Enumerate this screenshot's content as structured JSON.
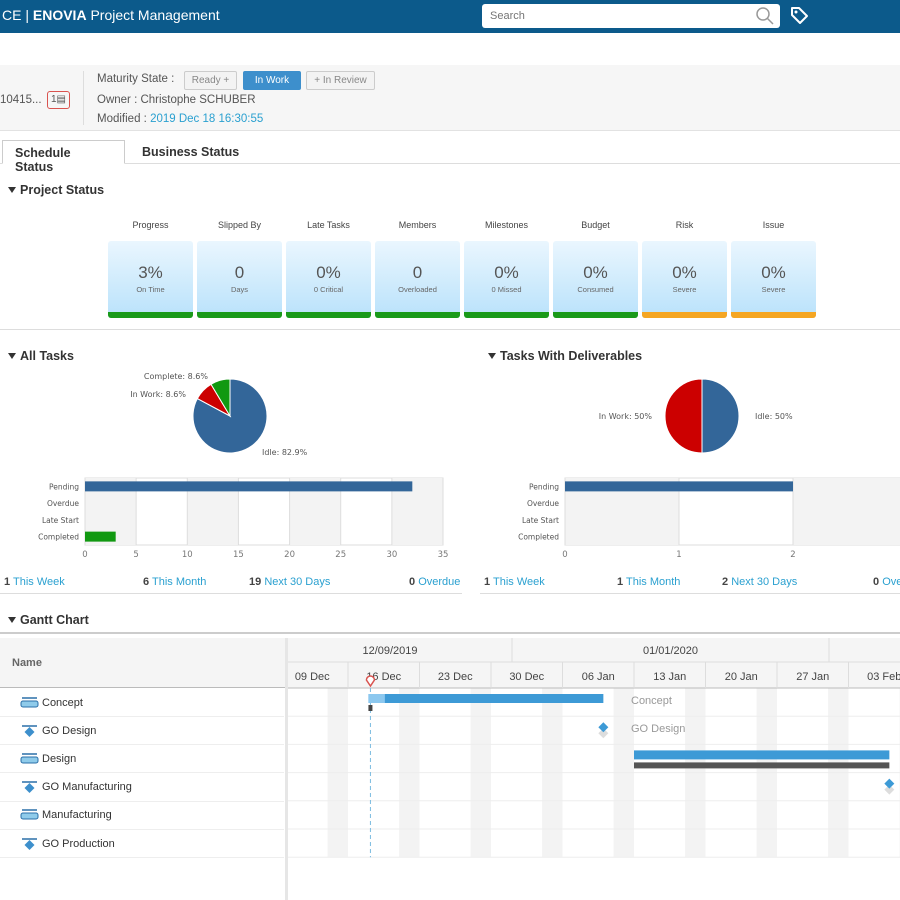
{
  "app": {
    "title_prefix": "CE | ",
    "brand": "ENOVIA",
    "title": " Project Management",
    "search_placeholder": "Search",
    "icons": [
      "search-icon",
      "tag-icon"
    ]
  },
  "object": {
    "id": "10415...",
    "badge": "1",
    "maturity_label": "Maturity State :",
    "states": [
      "Ready",
      "In Work",
      "In Review"
    ],
    "active_state": "In Work",
    "owner": "Owner : Christophe SCHUBER",
    "modified_label": "Modified :",
    "modified": "2019 Dec 18 16:30:55"
  },
  "tabs": [
    {
      "label": "Schedule Status",
      "active": true
    },
    {
      "label": "Business Status",
      "active": false
    }
  ],
  "project_status": {
    "title": "Project Status",
    "cards": [
      {
        "label": "Progress",
        "value": "3%",
        "sub": "On Time",
        "color": "#1a9a1a"
      },
      {
        "label": "Slipped By",
        "value": "0",
        "sub": "Days",
        "color": "#1a9a1a"
      },
      {
        "label": "Late Tasks",
        "value": "0%",
        "sub": "0 Critical",
        "color": "#1a9a1a"
      },
      {
        "label": "Members",
        "value": "0",
        "sub": "Overloaded",
        "color": "#1a9a1a"
      },
      {
        "label": "Milestones",
        "value": "0%",
        "sub": "0 Missed",
        "color": "#1a9a1a"
      },
      {
        "label": "Budget",
        "value": "0%",
        "sub": "Consumed",
        "color": "#1a9a1a"
      },
      {
        "label": "Risk",
        "value": "0%",
        "sub": "Severe",
        "color": "#f5a623"
      },
      {
        "label": "Issue",
        "value": "0%",
        "sub": "Severe",
        "color": "#f5a623"
      }
    ]
  },
  "chart_data": [
    {
      "type": "pie",
      "title": "All Tasks",
      "slices": [
        {
          "label": "Idle: 82.9%",
          "value": 82.9,
          "color": "#336699"
        },
        {
          "label": "In Work: 8.6%",
          "value": 8.6,
          "color": "#cc0000"
        },
        {
          "label": "Complete: 8.6%",
          "value": 8.6,
          "color": "#119911"
        }
      ]
    },
    {
      "type": "bar",
      "orientation": "horizontal",
      "categories": [
        "Pending",
        "Overdue",
        "Late Start",
        "Completed"
      ],
      "values": [
        32,
        0,
        0,
        3
      ],
      "colors": [
        "#336699",
        "#336699",
        "#336699",
        "#119911"
      ],
      "xlim": [
        0,
        35
      ],
      "xticks": [
        "0",
        "5",
        "10",
        "15",
        "20",
        "25",
        "30",
        "35"
      ],
      "grid": true
    },
    {
      "type": "pie",
      "title": "Tasks With Deliverables",
      "slices": [
        {
          "label": "Idle: 50%",
          "value": 50,
          "color": "#336699"
        },
        {
          "label": "In Work: 50%",
          "value": 50,
          "color": "#cc0000"
        }
      ]
    },
    {
      "type": "bar",
      "orientation": "horizontal",
      "categories": [
        "Pending",
        "Overdue",
        "Late Start",
        "Completed"
      ],
      "values": [
        2,
        0,
        0,
        0
      ],
      "colors": [
        "#336699",
        "#336699",
        "#336699",
        "#119911"
      ],
      "xlim": [
        0,
        3
      ],
      "xticks": [
        "0",
        "1",
        "2"
      ],
      "grid": true
    }
  ],
  "all_tasks_stats": [
    {
      "n": "1",
      "label": "This Week"
    },
    {
      "n": "6",
      "label": "This Month"
    },
    {
      "n": "19",
      "label": "Next 30 Days"
    },
    {
      "n": "0",
      "label": "Overdue"
    }
  ],
  "deliv_stats": [
    {
      "n": "1",
      "label": "This Week"
    },
    {
      "n": "1",
      "label": "This Month"
    },
    {
      "n": "2",
      "label": "Next 30 Days"
    },
    {
      "n": "0",
      "label": "Ove"
    }
  ],
  "gantt": {
    "title": "Gantt Chart",
    "name_header": "Name",
    "periods": [
      "12/09/2019",
      "01/01/2020"
    ],
    "weeks": [
      "09 Dec",
      "16 Dec",
      "23 Dec",
      "30 Dec",
      "06 Jan",
      "13 Jan",
      "20 Jan",
      "27 Jan",
      "03 Feb"
    ],
    "today": "2019-12-18",
    "tasks": [
      {
        "name": "Concept",
        "type": "task",
        "start": "2019-12-18",
        "end": "2020-01-10",
        "progress": 0.07,
        "label": "Concept"
      },
      {
        "name": "GO Design",
        "type": "milestone",
        "date": "2020-01-10",
        "label": "GO Design"
      },
      {
        "name": "Design",
        "type": "task",
        "start": "2020-01-13",
        "end": "2020-02-07",
        "progress": 0,
        "label": ""
      },
      {
        "name": "GO Manufacturing",
        "type": "milestone",
        "date": "2020-02-07",
        "label": ""
      },
      {
        "name": "Manufacturing",
        "type": "task"
      },
      {
        "name": "GO Production",
        "type": "milestone"
      }
    ]
  }
}
